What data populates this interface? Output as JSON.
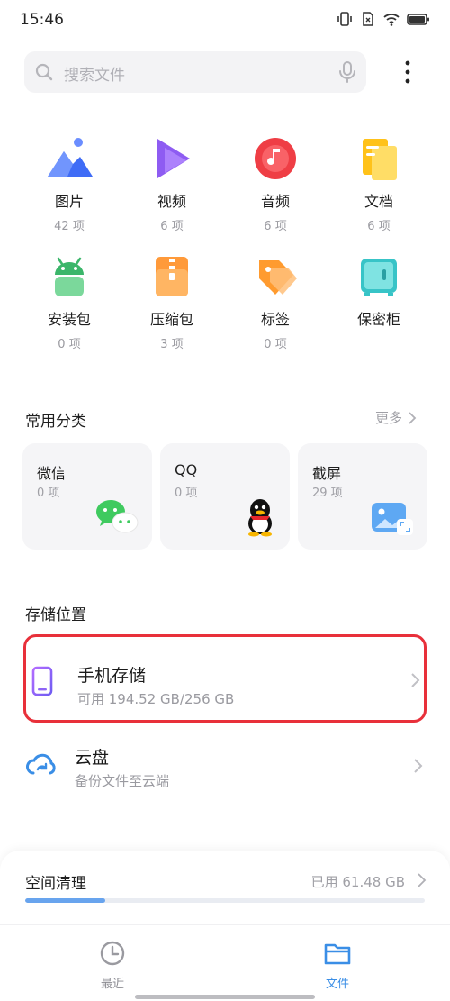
{
  "status_bar": {
    "time": "15:46",
    "icons": [
      "vibrate-icon",
      "sim-off-icon",
      "wifi-icon",
      "battery-icon"
    ]
  },
  "search": {
    "placeholder": "搜索文件",
    "icon": "search-icon",
    "mic_icon": "mic-icon"
  },
  "categories": [
    {
      "name": "图片",
      "count": "42 项",
      "icon": "picture-icon"
    },
    {
      "name": "视频",
      "count": "6 项",
      "icon": "video-icon"
    },
    {
      "name": "音频",
      "count": "6 项",
      "icon": "music-icon"
    },
    {
      "name": "文档",
      "count": "6 项",
      "icon": "document-icon"
    },
    {
      "name": "安装包",
      "count": "0 项",
      "icon": "android-icon"
    },
    {
      "name": "压缩包",
      "count": "3 项",
      "icon": "archive-icon"
    },
    {
      "name": "标签",
      "count": "0 项",
      "icon": "tag-icon"
    },
    {
      "name": "保密柜",
      "count": "",
      "icon": "safe-icon"
    }
  ],
  "common": {
    "title": "常用分类",
    "more": "更多",
    "cards": [
      {
        "name": "微信",
        "count": "0 项",
        "icon": "wechat-icon"
      },
      {
        "name": "QQ",
        "count": "0 项",
        "icon": "qq-icon"
      },
      {
        "name": "截屏",
        "count": "29 项",
        "icon": "screenshot-icon"
      }
    ]
  },
  "storage": {
    "title": "存储位置",
    "phone": {
      "title": "手机存储",
      "sub": "可用 194.52 GB/256 GB"
    },
    "cloud": {
      "title": "云盘",
      "sub": "备份文件至云端"
    }
  },
  "cleanup": {
    "title": "空间清理",
    "used": "已用 61.48 GB",
    "progress_fraction": 0.2
  },
  "nav": [
    {
      "label": "最近",
      "icon": "clock-icon",
      "active": false
    },
    {
      "label": "文件",
      "icon": "folder-icon",
      "active": true
    }
  ],
  "colors": {
    "accent": "#3a8ee6",
    "highlight": "#e8303a",
    "progress": "#68a4ee"
  }
}
